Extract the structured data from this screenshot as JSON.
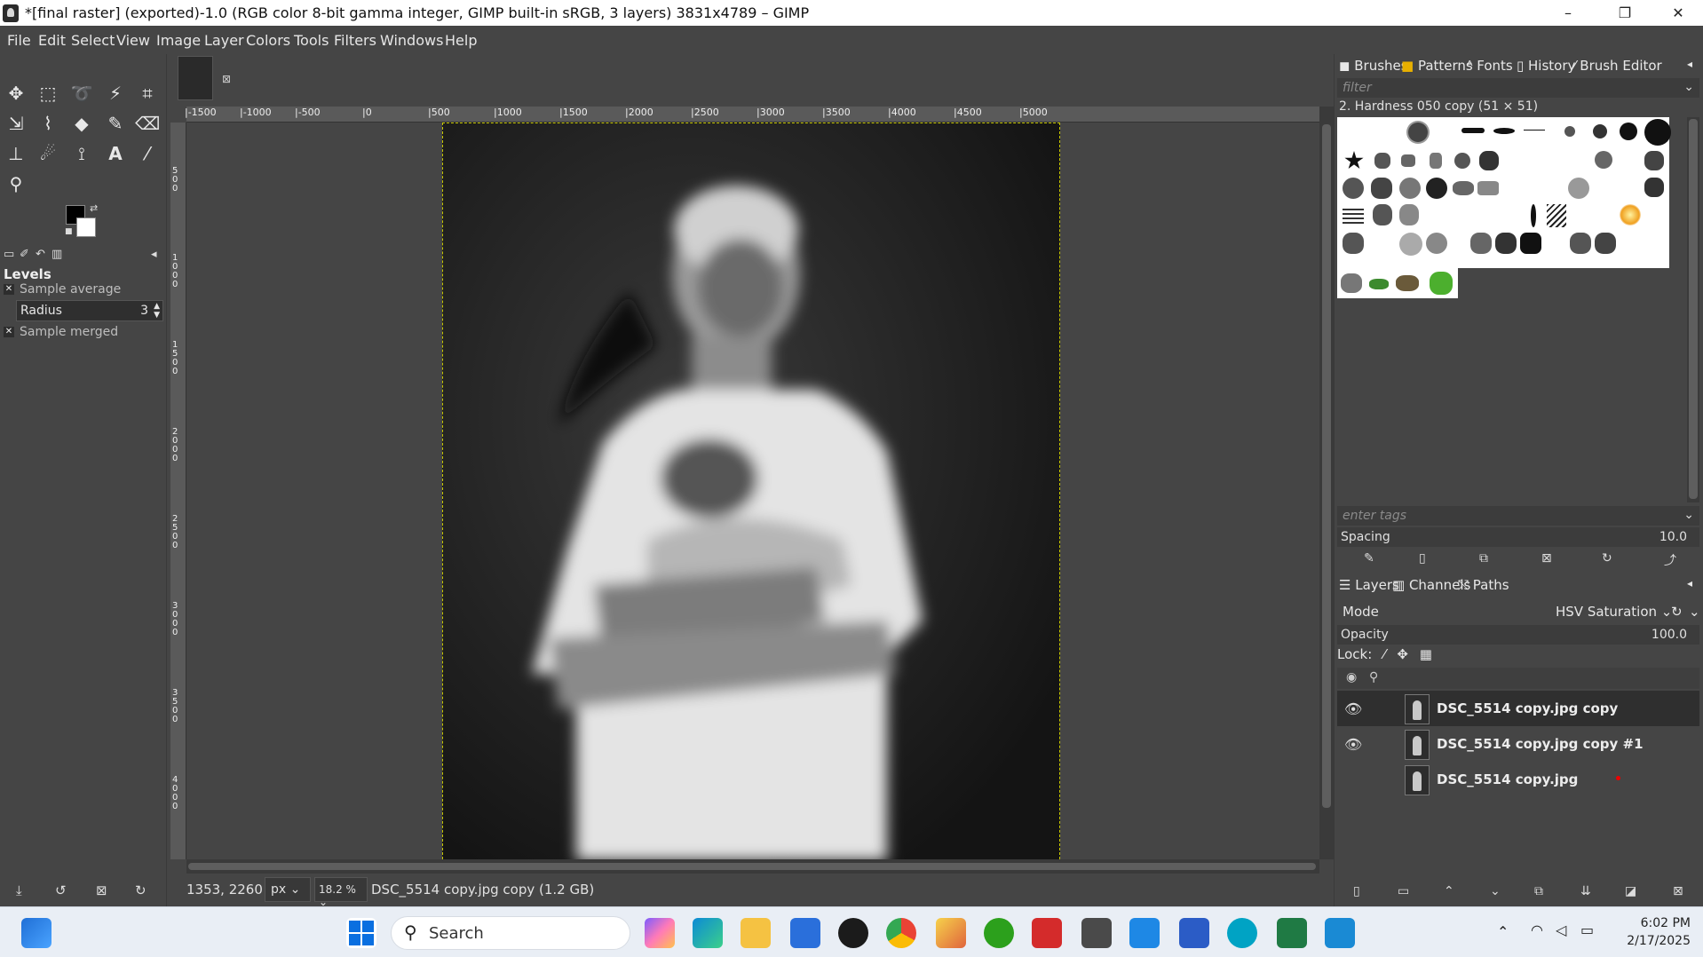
{
  "window": {
    "title": "*[final raster] (exported)-1.0 (RGB color 8-bit gamma integer, GIMP built-in sRGB, 3 layers) 3831x4789 – GIMP",
    "minimize": "–",
    "maximize": "❐",
    "close": "✕"
  },
  "menu": [
    "File",
    "Edit",
    "Select",
    "View",
    "Image",
    "Layer",
    "Colors",
    "Tools",
    "Filters",
    "Windows",
    "Help"
  ],
  "tool_options": {
    "title": "Levels",
    "sample_average": "Sample average",
    "radius_label": "Radius",
    "radius_value": "3",
    "sample_merged": "Sample merged"
  },
  "ruler": {
    "h_ticks": [
      "-1500",
      "-1000",
      "-500",
      "0",
      "500",
      "1000",
      "1500",
      "2000",
      "2500",
      "3000",
      "3500",
      "4000",
      "4500",
      "5000"
    ],
    "v_ticks": [
      "500",
      "1000",
      "1500",
      "2000",
      "2500",
      "3000",
      "3500",
      "4000"
    ]
  },
  "status": {
    "coords": "1353, 2260",
    "unit": "px",
    "zoom": "18.2 %",
    "message": "DSC_5514 copy.jpg copy (1.2 GB)"
  },
  "dock_top": {
    "tabs": [
      "Brushes",
      "Patterns",
      "Fonts",
      "History",
      "Brush Editor"
    ],
    "filter_placeholder": "filter",
    "brush_name": "2. Hardness 050 copy (51 × 51)",
    "tags_placeholder": "enter tags",
    "spacing_label": "Spacing",
    "spacing_value": "10.0"
  },
  "dock_bottom": {
    "tabs": [
      "Layers",
      "Channels",
      "Paths"
    ],
    "mode_label": "Mode",
    "mode_value": "HSV Saturation",
    "opacity_label": "Opacity",
    "opacity_value": "100.0",
    "lock_label": "Lock:",
    "layers": [
      {
        "name": "DSC_5514 copy.jpg copy",
        "visible": true,
        "selected": true
      },
      {
        "name": "DSC_5514 copy.jpg copy #1",
        "visible": true,
        "selected": false
      },
      {
        "name": "DSC_5514 copy.jpg",
        "visible": false,
        "selected": false
      }
    ]
  },
  "taskbar": {
    "search_placeholder": "Search",
    "time": "6:02 PM",
    "date": "2/17/2025"
  },
  "colors": {
    "fg": "#000000",
    "bg": "#ffffff",
    "selection_border": "#c8c800"
  }
}
